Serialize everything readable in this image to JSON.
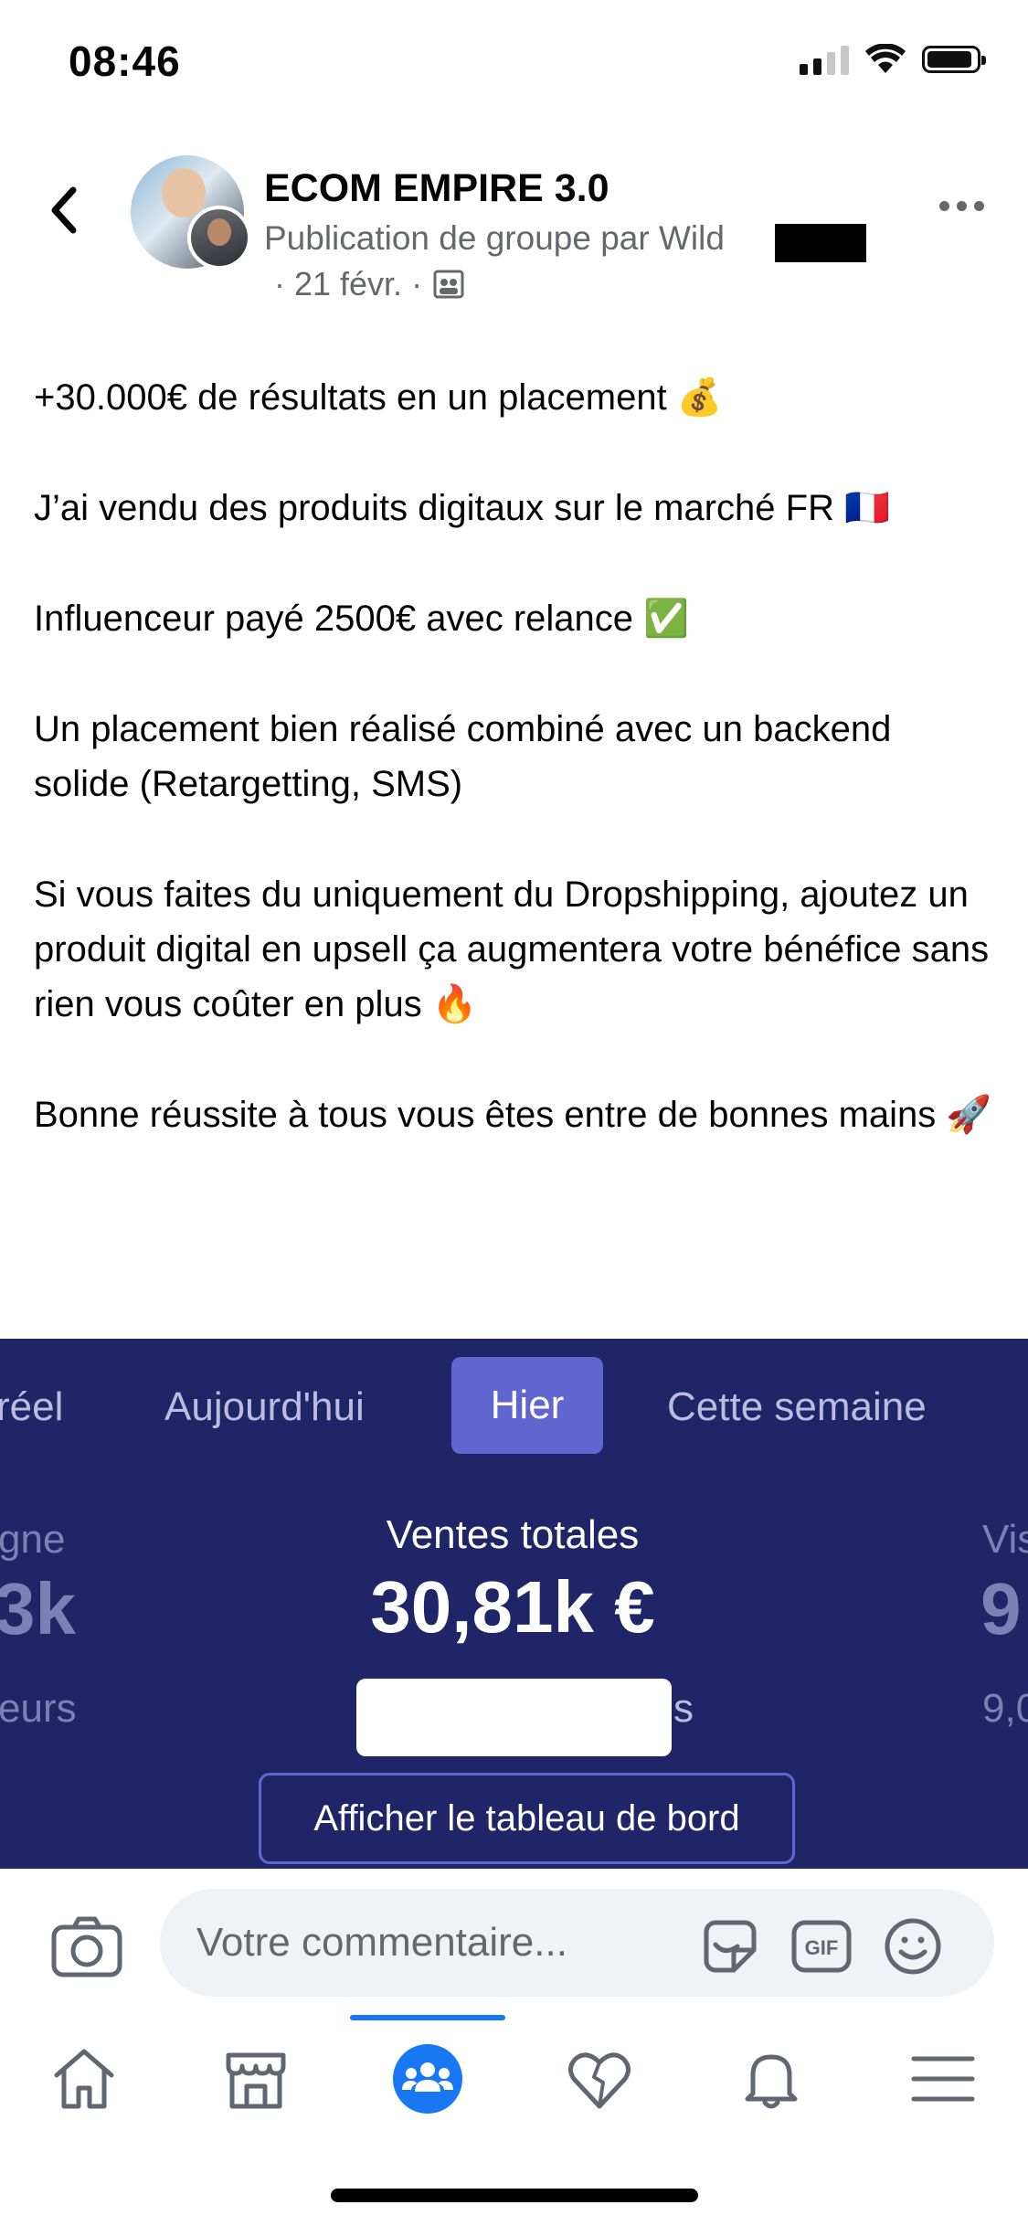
{
  "status_bar": {
    "time": "08:46"
  },
  "post_header": {
    "group_name": "ECOM EMPIRE 3.0",
    "subtitle": "Publication de groupe par Wild",
    "date": "· 21 févr. ·"
  },
  "post": {
    "paragraphs": [
      "+30.000€ de résultats en un placement 💰",
      "J’ai vendu des produits digitaux sur le marché FR 🇫🇷",
      "Influenceur payé 2500€ avec relance ✅",
      "Un placement bien réalisé combiné avec un backend solide (Retargetting, SMS)",
      "Si vous faites du uniquement du Dropshipping, ajoutez un produit digital en upsell ça augmentera votre bénéfice sans rien vous coûter en plus 🔥",
      "Bonne réussite à tous vous êtes entre de bonnes mains 🚀"
    ]
  },
  "embed": {
    "tabs": [
      "réel",
      "Aujourd'hui",
      "Hier",
      "Cette semaine"
    ],
    "active_tab": "Hier",
    "left_partial": [
      "gne",
      "3k",
      "eurs"
    ],
    "right_partial": [
      "Vis",
      "9",
      "9,0"
    ],
    "sales_label": "Ventes totales",
    "sales_value": "30,81k €",
    "suffix": "s",
    "dashboard_button": "Afficher le tableau de bord",
    "colors": {
      "background": "#1f2566",
      "active_tab": "#5f66cf"
    }
  },
  "comment_bar": {
    "placeholder": "Votre commentaire...",
    "icons": [
      "camera-icon",
      "sticker-icon",
      "gif-icon",
      "emoji-icon"
    ]
  },
  "tab_bar": {
    "items": [
      "home-icon",
      "marketplace-icon",
      "groups-icon",
      "dating-icon",
      "notifications-icon",
      "menu-icon"
    ],
    "active": "groups-icon",
    "accent": "#1877f2"
  }
}
